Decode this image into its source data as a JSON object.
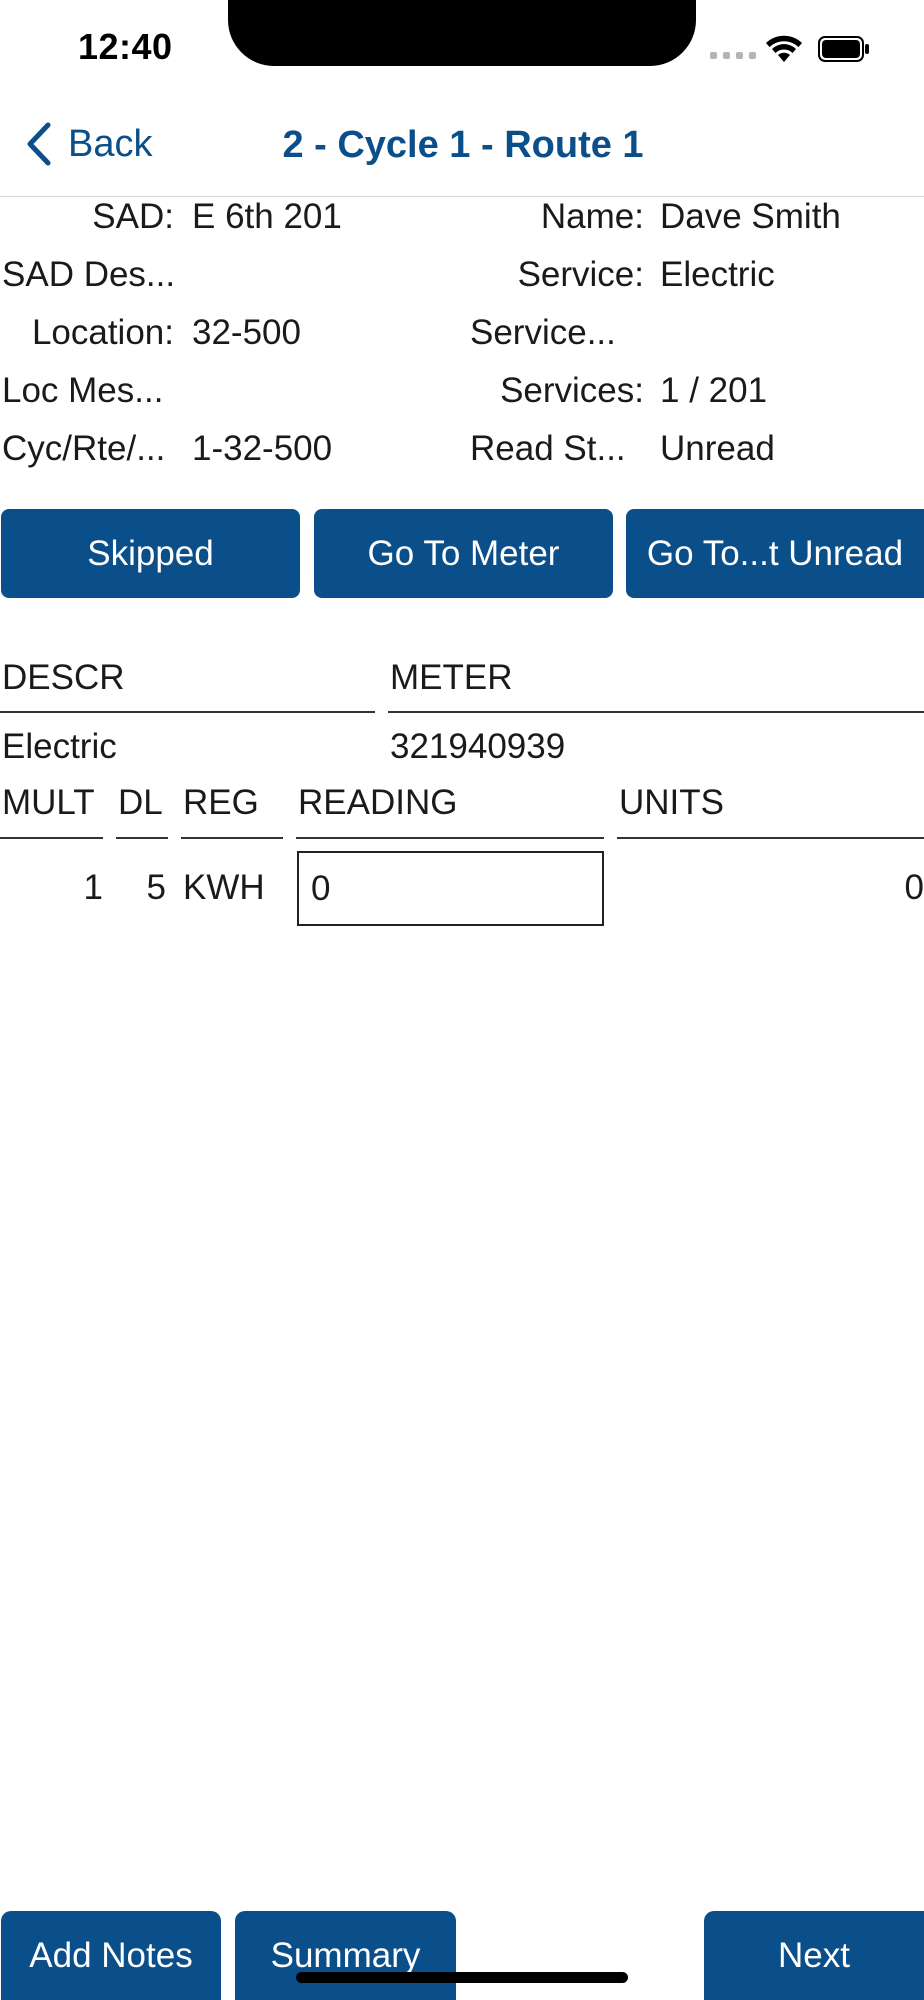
{
  "status_bar": {
    "time": "12:40"
  },
  "nav": {
    "back_label": "Back",
    "title": "2 - Cycle 1 - Route 1"
  },
  "info": {
    "sad_label": "SAD:",
    "sad_value": "E 6th 201",
    "name_label": "Name:",
    "name_value": "Dave Smith",
    "sad_desc_label": "SAD Des...",
    "service_label": "Service:",
    "service_value": "Electric",
    "location_label": "Location:",
    "location_value": "32-500",
    "service2_label": "Service...",
    "loc_mes_label": "Loc Mes...",
    "services_label": "Services:",
    "services_value": "1 / 201",
    "cyc_label": "Cyc/Rte/...",
    "cyc_value": "1-32-500",
    "read_st_label": "Read St...",
    "read_st_value": "Unread"
  },
  "actions": {
    "skipped": "Skipped",
    "go_to_meter": "Go To Meter",
    "go_to_unread": "Go To...t Unread"
  },
  "meter_table": {
    "headers": {
      "descr": "DESCR",
      "meter": "METER"
    },
    "row": {
      "descr": "Electric",
      "meter": "321940939"
    }
  },
  "register_table": {
    "headers": {
      "mult": "MULT",
      "dl": "DL",
      "reg": "REG",
      "reading": "READING",
      "units": "UNITS"
    },
    "row": {
      "mult": "1",
      "dl": "5",
      "reg": "KWH",
      "reading": "0",
      "units": "0"
    }
  },
  "footer": {
    "add_notes": "Add Notes",
    "summary": "Summary",
    "next": "Next"
  },
  "colors": {
    "accent": "#0b4f8a"
  }
}
